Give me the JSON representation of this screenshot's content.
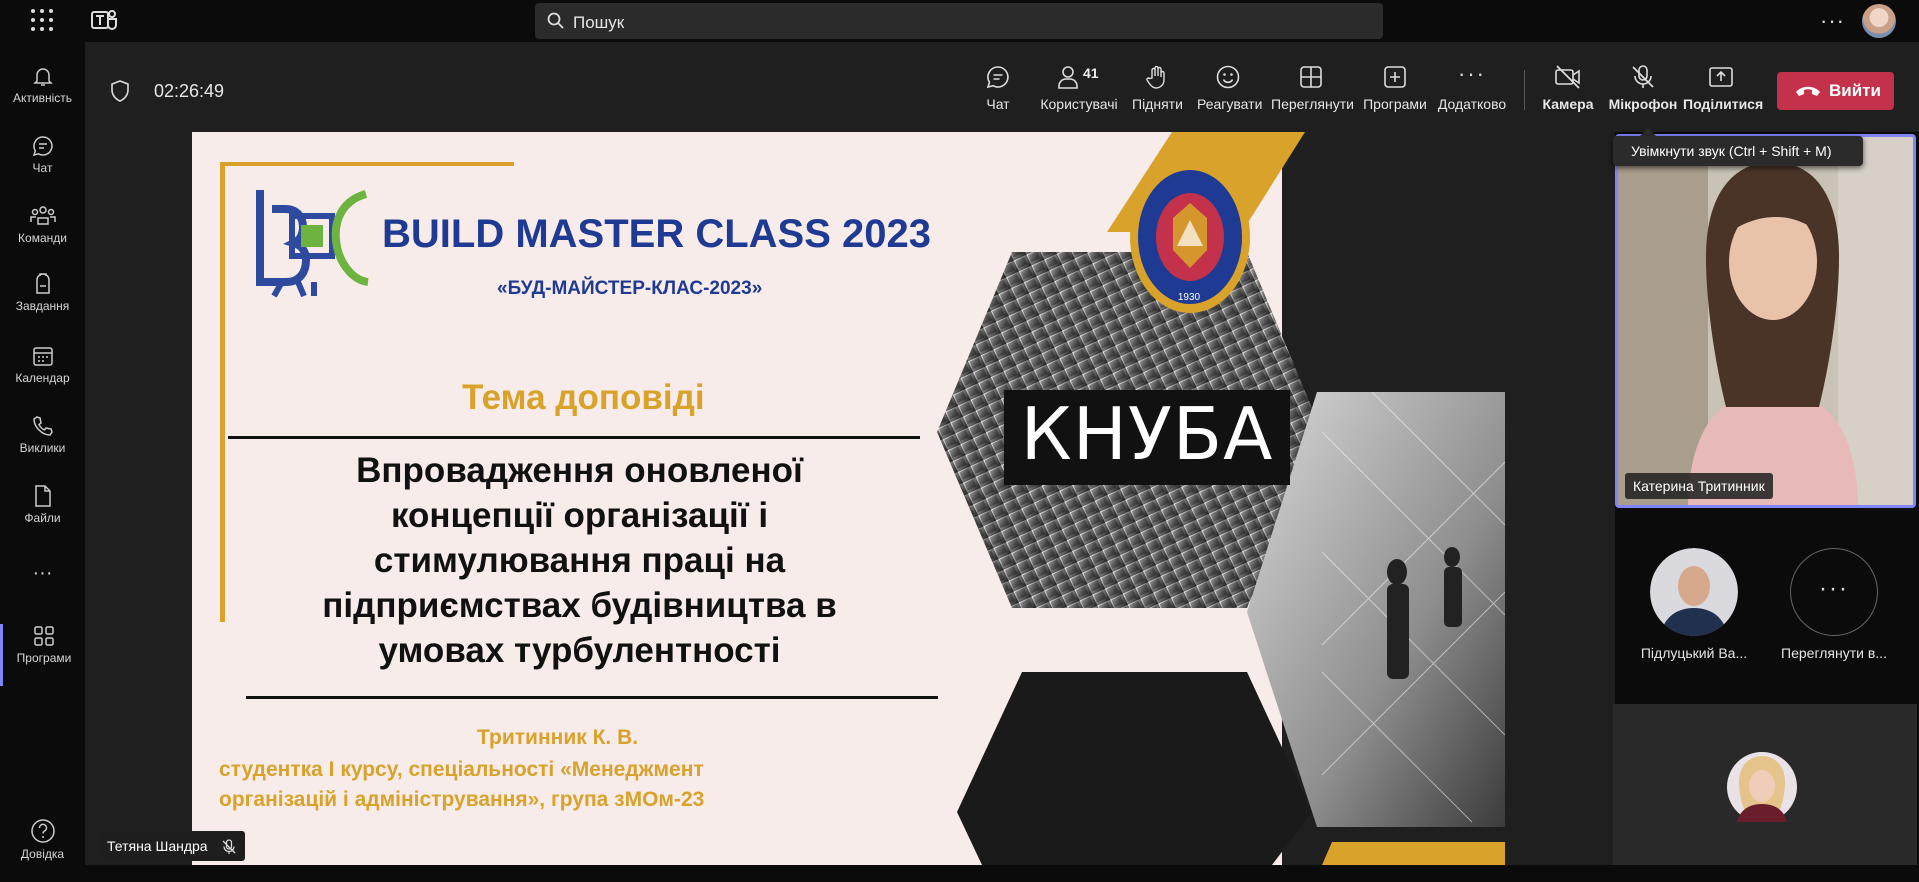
{
  "search": {
    "placeholder": "Пошук"
  },
  "sidebar": {
    "items": [
      {
        "label": "Активність",
        "icon": "bell-icon"
      },
      {
        "label": "Чат",
        "icon": "chat-icon"
      },
      {
        "label": "Команди",
        "icon": "teams-icon"
      },
      {
        "label": "Завдання",
        "icon": "backpack-icon"
      },
      {
        "label": "Календар",
        "icon": "calendar-icon"
      },
      {
        "label": "Виклики",
        "icon": "phone-icon"
      },
      {
        "label": "Файли",
        "icon": "file-icon"
      },
      {
        "label": "Програми",
        "icon": "apps-icon"
      },
      {
        "label": "Довідка",
        "icon": "help-icon"
      }
    ],
    "more": "···"
  },
  "meeting": {
    "timer": "02:26:49",
    "participant_count": "41",
    "toolbar": {
      "chat": "Чат",
      "people": "Користувачі",
      "raise": "Підняти",
      "react": "Реагувати",
      "view": "Переглянути",
      "apps": "Програми",
      "more": "Додатково",
      "camera": "Камера",
      "mic": "Мікрофон",
      "share": "Поділитися",
      "leave": "Вийти"
    },
    "tooltip": "Увімкнути звук (Ctrl + Shift + M)"
  },
  "slide": {
    "title": "BUILD MASTER CLASS 2023",
    "subtitle": "«БУД-МАЙСТЕР-КЛАС-2023»",
    "tema": "Тема доповіді",
    "topic_lines": [
      "Впровадження оновленої",
      "концепції організації і",
      "стимулювання праці на",
      "підприємствах будівництва в",
      "умовах турбулентності"
    ],
    "author": "Тритинник К. В.",
    "author_desc_lines": [
      "студентка I курсу, спеціальності «Менеджмент",
      "організацій і адміністрування», група зМОм-23"
    ],
    "knuba": "КНУБА",
    "seal_year": "1930"
  },
  "participants": {
    "active_speaker": "Катерина Тритинник",
    "p1": "Підлуцький Ва...",
    "more": "Переглянути в...",
    "presenter": "Тетяна Шандра"
  },
  "colors": {
    "accent": "#7f85f5",
    "leave": "#c4314b",
    "gold": "#d8a22b",
    "navy": "#1f3a93"
  }
}
